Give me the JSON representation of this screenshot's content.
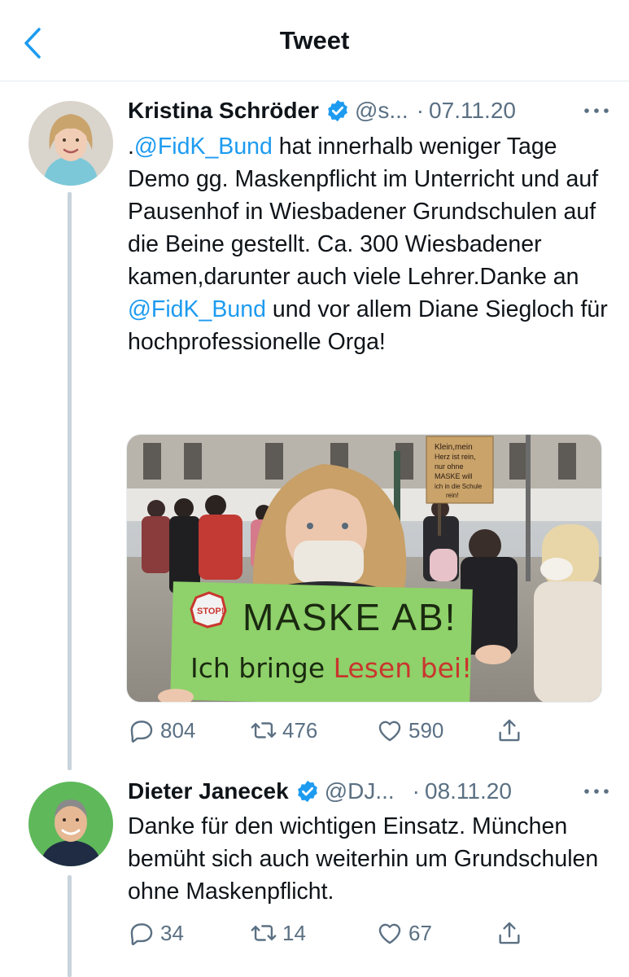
{
  "header": {
    "title": "Tweet"
  },
  "tweets": [
    {
      "author": "Kristina Schröder",
      "handle": "@s...",
      "date": "07.11.20",
      "text_parts": [
        ".",
        "@FidK_Bund",
        " hat innerhalb weniger Tage Demo gg. Maskenpflicht im Unterricht und auf Pausenhof in Wiesbadener Grundschulen auf die Beine gestellt. Ca. 300 Wiesbadener kamen,darunter auch viele Lehrer.Danke an ",
        "@FidK_Bund",
        " und vor allem Diane Siegloch für hochprofessionelle Orga!"
      ],
      "media": {
        "main_sign": {
          "stop": "STOP!",
          "line1": "MASKE AB!",
          "line2a": "Ich bringe ",
          "line2b": "Lesen bei!"
        },
        "back_sign": {
          "line1": "Klein,mein",
          "line2": "Herz ist rein,",
          "line3": "nur ohne",
          "line4": "MASKE will",
          "line5": "ich in die Schule",
          "line6": "rein!"
        }
      },
      "stats": {
        "replies": "804",
        "retweets": "476",
        "likes": "590"
      }
    },
    {
      "author": "Dieter Janecek",
      "handle": "@DJ...",
      "date": "08.11.20",
      "text": "Danke für den wichtigen Einsatz. München bemüht sich auch weiterhin um Grundschulen ohne Maskenpflicht.",
      "stats": {
        "replies": "34",
        "retweets": "14",
        "likes": "67"
      }
    }
  ],
  "colors": {
    "link": "#1d9bf0",
    "muted": "#5b7083",
    "verified": "#1d9bf0",
    "thread_line": "#c9d3db",
    "sign_green": "#8fd16a"
  },
  "icons": [
    "back-chevron-icon",
    "verified-badge-icon",
    "more-options-icon",
    "reply-icon",
    "retweet-icon",
    "like-icon",
    "share-icon"
  ]
}
